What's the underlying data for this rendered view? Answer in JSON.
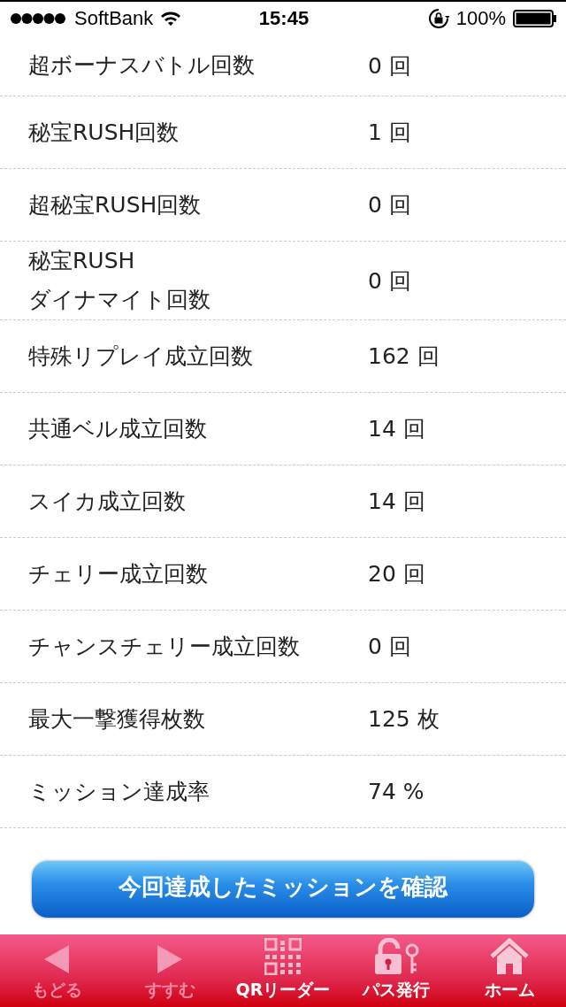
{
  "status_bar": {
    "carrier": "SoftBank",
    "time": "15:45",
    "battery": "100%"
  },
  "rows": [
    {
      "label": [
        "超ボーナスバトル回数"
      ],
      "value": "0 回"
    },
    {
      "label": [
        "秘宝RUSH回数"
      ],
      "value": "1 回"
    },
    {
      "label": [
        "超秘宝RUSH回数"
      ],
      "value": "0 回"
    },
    {
      "label": [
        "秘宝RUSH",
        "ダイナマイト回数"
      ],
      "value": "0 回"
    },
    {
      "label": [
        "特殊リプレイ成立回数"
      ],
      "value": "162 回"
    },
    {
      "label": [
        "共通ベル成立回数"
      ],
      "value": "14 回"
    },
    {
      "label": [
        "スイカ成立回数"
      ],
      "value": "14 回"
    },
    {
      "label": [
        "チェリー成立回数"
      ],
      "value": "20 回"
    },
    {
      "label": [
        "チャンスチェリー成立回数"
      ],
      "value": "0 回"
    },
    {
      "label": [
        "最大一撃獲得枚数"
      ],
      "value": "125 枚"
    },
    {
      "label": [
        "ミッション達成率"
      ],
      "value": "74 %"
    }
  ],
  "action_button": "今回達成したミッションを確認",
  "tab_bar": [
    {
      "kind": "back",
      "label": "もどる",
      "disabled": true
    },
    {
      "kind": "forward",
      "label": "すすむ",
      "disabled": true
    },
    {
      "kind": "qr",
      "label": "QRリーダー",
      "disabled": false
    },
    {
      "kind": "pass",
      "label": "パス発行",
      "disabled": false
    },
    {
      "kind": "home",
      "label": "ホーム",
      "disabled": false
    }
  ]
}
